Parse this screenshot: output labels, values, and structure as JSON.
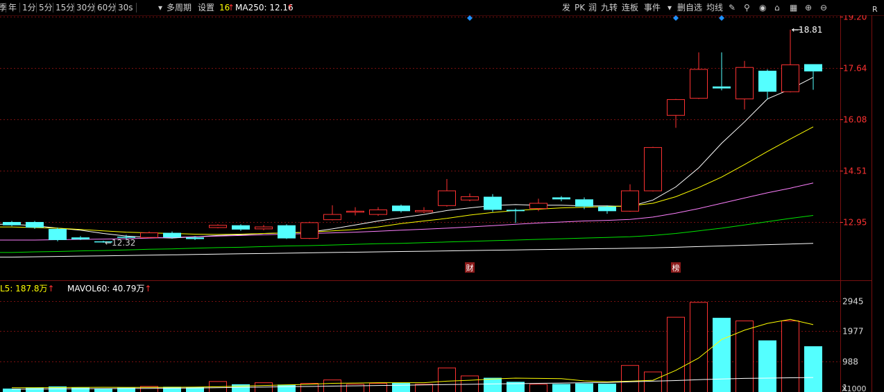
{
  "toolbar": {
    "periods": [
      "季",
      "年",
      "1分",
      "5分",
      "15分",
      "30分",
      "60分",
      "30s"
    ],
    "selected_index": -1,
    "multi_period": "多周期",
    "settings": "设置",
    "ma_count": "16",
    "ma_label": "MA250: 12.16",
    "right_tools": [
      "发",
      "PK",
      "润",
      "九转",
      "连板",
      "事件"
    ],
    "right_tools2": [
      "删自选",
      "均线"
    ]
  },
  "vol_info": {
    "mavol5": "L5: 187.8万",
    "mavol60": "MAVOL60: 40.79万"
  },
  "colors": {
    "up": "#ff3232",
    "down": "#54ffff",
    "ma5": "#ffffff",
    "ma10": "#ffff00",
    "ma20": "#ff80ff",
    "ma60": "#00e600",
    "ma250": "#ffffff",
    "grid": "#7a1010",
    "axis_text": "#ff3232",
    "marker": "#1e90ff"
  },
  "chart_data": {
    "type": "candlestick",
    "price_axis": {
      "ticks": [
        "19.20",
        "17.64",
        "16.08",
        "14.51",
        "12.95"
      ],
      "tick_values": [
        19.2,
        17.64,
        16.08,
        14.51,
        12.95
      ],
      "ylim": [
        11.3,
        19.25
      ]
    },
    "annotations": {
      "high_label": "18.81",
      "high_value": 18.81,
      "low_label": "12.32",
      "low_value": 12.32
    },
    "event_tags": [
      {
        "label": "财",
        "index": 20
      },
      {
        "label": "榜",
        "index": 29
      }
    ],
    "top_markers": [
      20,
      29,
      31
    ],
    "candles": [
      {
        "o": 12.95,
        "c": 12.85,
        "h": 12.98,
        "l": 12.82
      },
      {
        "o": 12.95,
        "c": 12.78,
        "h": 12.98,
        "l": 12.74
      },
      {
        "o": 12.74,
        "c": 12.4,
        "h": 12.78,
        "l": 12.36
      },
      {
        "o": 12.48,
        "c": 12.42,
        "h": 12.52,
        "l": 12.4
      },
      {
        "o": 12.36,
        "c": 12.34,
        "h": 12.38,
        "l": 12.32
      },
      {
        "o": 12.5,
        "c": 12.48,
        "h": 12.56,
        "l": 12.42
      },
      {
        "o": 12.48,
        "c": 12.62,
        "h": 12.66,
        "l": 12.46
      },
      {
        "o": 12.62,
        "c": 12.48,
        "h": 12.66,
        "l": 12.44
      },
      {
        "o": 12.48,
        "c": 12.43,
        "h": 12.52,
        "l": 12.4
      },
      {
        "o": 12.78,
        "c": 12.85,
        "h": 12.88,
        "l": 12.76
      },
      {
        "o": 12.85,
        "c": 12.72,
        "h": 12.88,
        "l": 12.68
      },
      {
        "o": 12.74,
        "c": 12.8,
        "h": 12.86,
        "l": 12.7
      },
      {
        "o": 12.85,
        "c": 12.45,
        "h": 12.88,
        "l": 12.43
      },
      {
        "o": 12.45,
        "c": 12.93,
        "h": 12.96,
        "l": 12.43
      },
      {
        "o": 13.02,
        "c": 13.18,
        "h": 13.46,
        "l": 13.0
      },
      {
        "o": 13.26,
        "c": 13.28,
        "h": 13.4,
        "l": 13.15
      },
      {
        "o": 13.18,
        "c": 13.32,
        "h": 13.4,
        "l": 13.14
      },
      {
        "o": 13.45,
        "c": 13.28,
        "h": 13.48,
        "l": 13.24
      },
      {
        "o": 13.26,
        "c": 13.3,
        "h": 13.4,
        "l": 13.22
      },
      {
        "o": 13.45,
        "c": 13.9,
        "h": 14.26,
        "l": 13.42
      },
      {
        "o": 13.62,
        "c": 13.72,
        "h": 13.82,
        "l": 13.58
      },
      {
        "o": 13.72,
        "c": 13.32,
        "h": 13.8,
        "l": 13.26
      },
      {
        "o": 13.32,
        "c": 13.28,
        "h": 13.36,
        "l": 12.92
      },
      {
        "o": 13.36,
        "c": 13.52,
        "h": 13.66,
        "l": 13.28
      },
      {
        "o": 13.7,
        "c": 13.64,
        "h": 13.74,
        "l": 13.58
      },
      {
        "o": 13.64,
        "c": 13.42,
        "h": 13.7,
        "l": 13.34
      },
      {
        "o": 13.42,
        "c": 13.28,
        "h": 13.46,
        "l": 13.2
      },
      {
        "o": 13.28,
        "c": 13.9,
        "h": 14.1,
        "l": 13.26
      },
      {
        "o": 13.9,
        "c": 15.22,
        "h": 15.24,
        "l": 13.88
      },
      {
        "o": 16.2,
        "c": 16.68,
        "h": 16.7,
        "l": 15.82
      },
      {
        "o": 16.72,
        "c": 17.6,
        "h": 18.12,
        "l": 16.7
      },
      {
        "o": 17.08,
        "c": 17.02,
        "h": 18.12,
        "l": 16.96
      },
      {
        "o": 16.7,
        "c": 17.66,
        "h": 17.86,
        "l": 16.38
      },
      {
        "o": 17.56,
        "c": 16.92,
        "h": 17.6,
        "l": 16.68
      },
      {
        "o": 16.92,
        "c": 17.74,
        "h": 18.81,
        "l": 16.9
      },
      {
        "o": 17.76,
        "c": 17.54,
        "h": 17.76,
        "l": 16.98
      }
    ],
    "ma_lines": {
      "ma5": [
        12.88,
        12.84,
        12.76,
        12.7,
        12.6,
        12.52,
        12.48,
        12.46,
        12.5,
        12.54,
        12.56,
        12.6,
        12.62,
        12.64,
        12.74,
        12.86,
        12.98,
        13.08,
        13.18,
        13.3,
        13.38,
        13.45,
        13.48,
        13.46,
        13.46,
        13.44,
        13.44,
        13.42,
        13.62,
        14.02,
        14.6,
        15.35,
        16.0,
        16.7,
        17.0,
        17.36
      ],
      "ma10": [
        12.8,
        12.78,
        12.76,
        12.72,
        12.68,
        12.64,
        12.62,
        12.6,
        12.58,
        12.57,
        12.58,
        12.6,
        12.62,
        12.64,
        12.68,
        12.72,
        12.8,
        12.9,
        12.98,
        13.06,
        13.16,
        13.24,
        13.3,
        13.34,
        13.38,
        13.4,
        13.42,
        13.44,
        13.52,
        13.72,
        14.0,
        14.32,
        14.7,
        15.1,
        15.48,
        15.85
      ],
      "ma20": [
        12.4,
        12.4,
        12.41,
        12.42,
        12.43,
        12.44,
        12.46,
        12.48,
        12.5,
        12.52,
        12.54,
        12.56,
        12.58,
        12.6,
        12.62,
        12.64,
        12.67,
        12.7,
        12.73,
        12.76,
        12.8,
        12.84,
        12.88,
        12.92,
        12.95,
        12.98,
        13.0,
        13.03,
        13.1,
        13.22,
        13.36,
        13.52,
        13.68,
        13.84,
        13.98,
        14.14
      ],
      "ma60": [
        12.02,
        12.04,
        12.05,
        12.07,
        12.08,
        12.1,
        12.12,
        12.13,
        12.15,
        12.17,
        12.18,
        12.2,
        12.22,
        12.23,
        12.25,
        12.27,
        12.29,
        12.3,
        12.32,
        12.34,
        12.36,
        12.38,
        12.4,
        12.42,
        12.44,
        12.46,
        12.48,
        12.5,
        12.54,
        12.6,
        12.68,
        12.76,
        12.86,
        12.96,
        13.06,
        13.15
      ],
      "ma250": [
        11.88,
        11.89,
        11.9,
        11.91,
        11.92,
        11.93,
        11.94,
        11.95,
        11.96,
        11.97,
        11.98,
        11.99,
        12.0,
        12.01,
        12.02,
        12.03,
        12.04,
        12.05,
        12.06,
        12.07,
        12.08,
        12.09,
        12.1,
        12.11,
        12.12,
        12.13,
        12.14,
        12.15,
        12.16,
        12.18,
        12.2,
        12.22,
        12.24,
        12.26,
        12.28,
        12.3
      ]
    },
    "volume_axis": {
      "ticks": [
        "2945",
        "1977",
        "988",
        "1"
      ],
      "tick_values": [
        2945,
        1977,
        988,
        1
      ],
      "unit": "X1000",
      "ylim": [
        0,
        3300
      ]
    },
    "volumes": [
      110,
      140,
      180,
      140,
      120,
      140,
      180,
      170,
      160,
      340,
      250,
      300,
      240,
      280,
      390,
      250,
      280,
      300,
      250,
      780,
      520,
      460,
      330,
      250,
      260,
      280,
      270,
      860,
      650,
      2420,
      2900,
      2400,
      2300,
      1670,
      2300,
      1480
    ],
    "mavol_lines": {
      "mavol5": [
        140,
        140,
        145,
        150,
        155,
        150,
        150,
        155,
        160,
        170,
        190,
        210,
        230,
        250,
        280,
        290,
        300,
        300,
        300,
        350,
        380,
        420,
        450,
        440,
        430,
        360,
        330,
        350,
        380,
        700,
        1100,
        1700,
        2000,
        2220,
        2350,
        2180
      ],
      "mavol60": [
        90,
        95,
        100,
        105,
        110,
        115,
        120,
        125,
        130,
        140,
        150,
        160,
        170,
        180,
        190,
        200,
        210,
        220,
        230,
        240,
        250,
        260,
        270,
        280,
        290,
        300,
        310,
        330,
        350,
        370,
        400,
        420,
        440,
        450,
        460,
        470
      ]
    }
  }
}
